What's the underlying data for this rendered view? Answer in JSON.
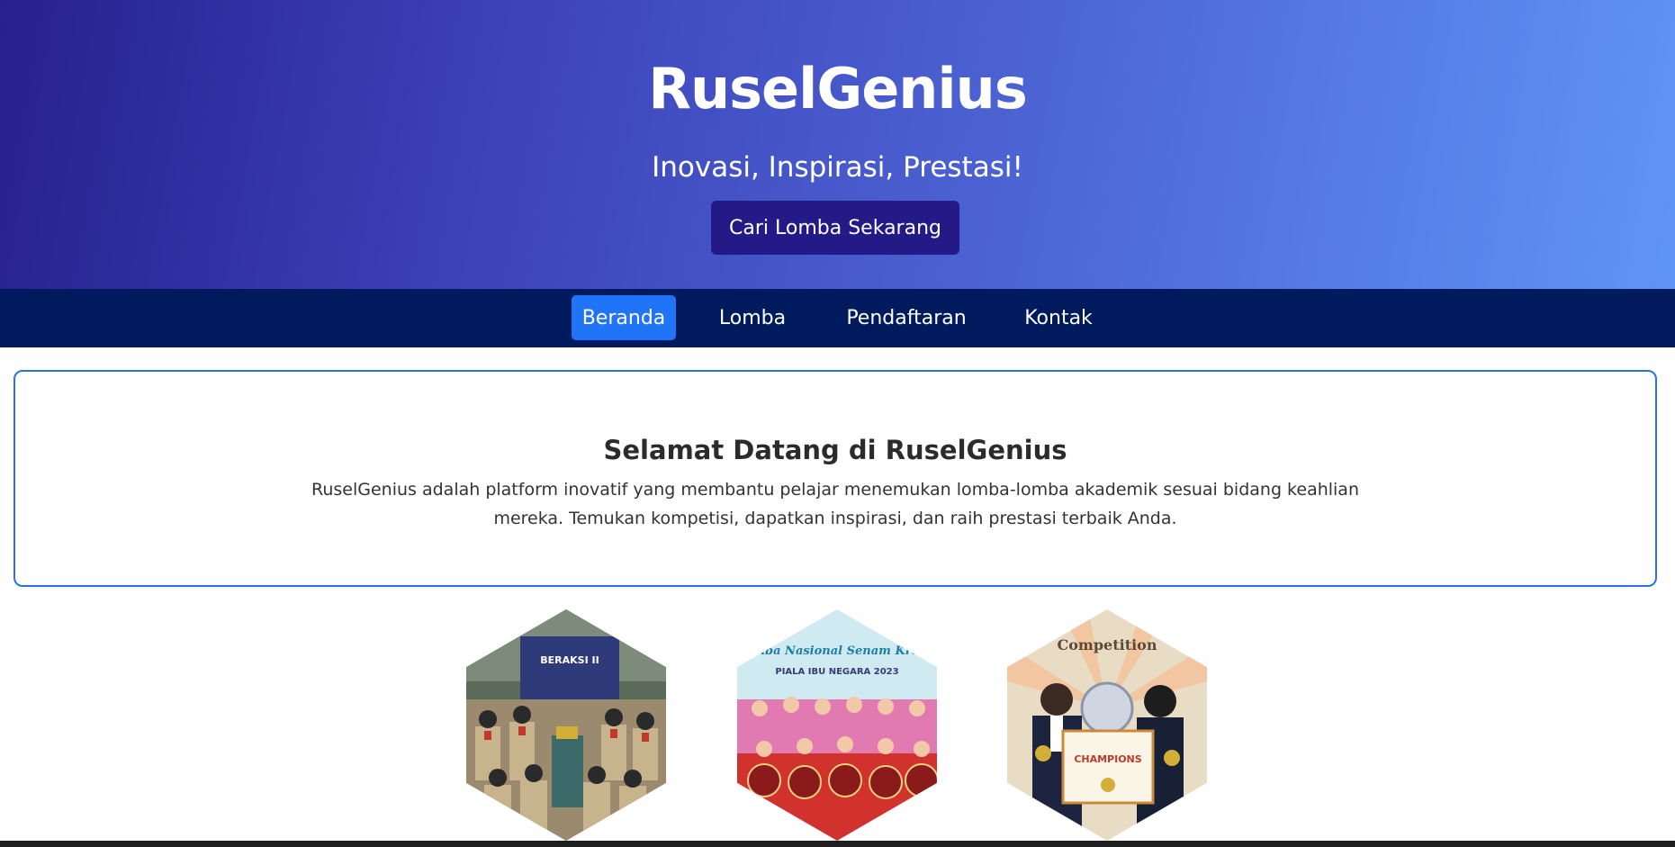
{
  "hero": {
    "title": "RuselGenius",
    "tagline": "Inovasi, Inspirasi, Prestasi!",
    "cta_label": "Cari Lomba Sekarang"
  },
  "nav": {
    "items": [
      {
        "label": "Beranda",
        "active": true
      },
      {
        "label": "Lomba",
        "active": false
      },
      {
        "label": "Pendaftaran",
        "active": false
      },
      {
        "label": "Kontak",
        "active": false
      }
    ]
  },
  "welcome": {
    "title": "Selamat Datang di RuselGenius",
    "text": "RuselGenius adalah platform inovatif yang membantu pelajar menemukan lomba-lomba akademik sesuai bidang keahlian mereka. Temukan kompetisi, dapatkan inspirasi, dan raih prestasi terbaik Anda."
  },
  "gallery": {
    "items": [
      {
        "banner_text": "BERAKSI II"
      },
      {
        "banner_text": "Lomba Nasional Senam Kreasi",
        "banner_subtext": "PIALA IBU NEGARA 2023"
      },
      {
        "banner_text": "Competition",
        "certificate_text": "CHAMPIONS"
      }
    ]
  },
  "colors": {
    "hero_start": "#27208f",
    "hero_end": "#5f95f6",
    "cta_bg": "#231987",
    "nav_bg": "#001a5e",
    "nav_active": "#1f74f7",
    "card_border": "#2a73e6"
  }
}
